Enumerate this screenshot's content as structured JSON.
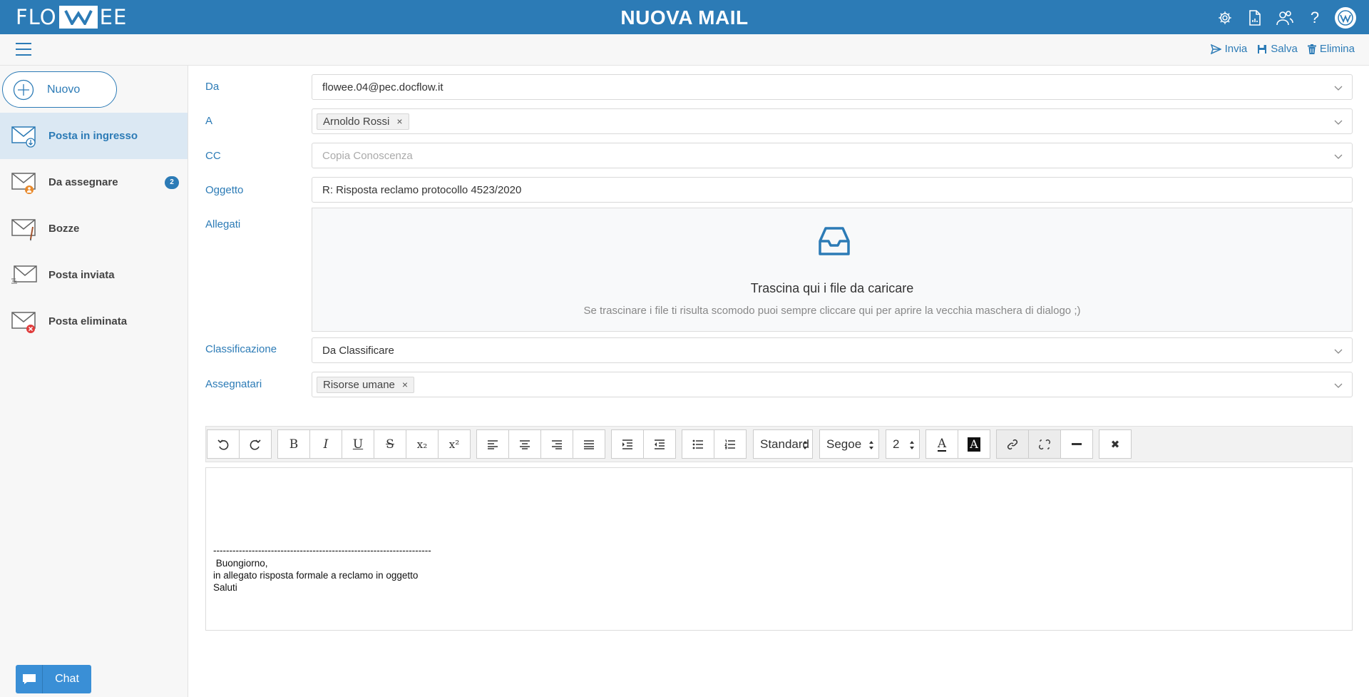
{
  "header": {
    "logo_left": "FLO",
    "logo_right": "EE",
    "title": "NUOVA MAIL",
    "icons": [
      "gear-icon",
      "report-icon",
      "users-icon",
      "help-icon",
      "avatar"
    ],
    "help_glyph": "?"
  },
  "toolbar": {
    "send_label": "Invia",
    "save_label": "Salva",
    "delete_label": "Elimina"
  },
  "sidebar": {
    "new_label": "Nuovo",
    "items": [
      {
        "label": "Posta in ingresso",
        "icon": "inbox-icon",
        "active": true
      },
      {
        "label": "Da assegnare",
        "icon": "to-assign-icon",
        "badge": "2"
      },
      {
        "label": "Bozze",
        "icon": "drafts-icon"
      },
      {
        "label": "Posta inviata",
        "icon": "sent-icon"
      },
      {
        "label": "Posta eliminata",
        "icon": "deleted-icon"
      }
    ],
    "chat_label": "Chat"
  },
  "form": {
    "from": {
      "label": "Da",
      "value": "flowee.04@pec.docflow.it"
    },
    "to": {
      "label": "A",
      "tag": "Arnoldo Rossi"
    },
    "cc": {
      "label": "CC",
      "placeholder": "Copia Conoscenza"
    },
    "subject": {
      "label": "Oggetto",
      "value": "R: Risposta reclamo protocollo 4523/2020"
    },
    "attachments": {
      "label": "Allegati",
      "title": "Trascina qui i file da caricare",
      "subtitle": "Se trascinare i file ti risulta scomodo puoi sempre cliccare qui per aprire la vecchia maschera di dialogo ;)"
    },
    "classification": {
      "label": "Classificazione",
      "value": "Da Classificare"
    },
    "assignees": {
      "label": "Assegnatari",
      "tag": "Risorse umane"
    }
  },
  "editor": {
    "font_size_style": "Standard",
    "font_family": "Segoe",
    "font_size": "2",
    "buttons": {
      "bold": "B",
      "italic": "I",
      "underline": "U",
      "strike": "S",
      "subscript": "x₂",
      "superscript": "x²",
      "text_color": "A",
      "highlight": "A",
      "remove": "✖"
    },
    "body": {
      "separator": "--------------------------------------------------------------------",
      "line1": " Buongiorno,",
      "line2": "in allegato risposta formale a reclamo in oggetto",
      "line3": "Saluti"
    }
  }
}
